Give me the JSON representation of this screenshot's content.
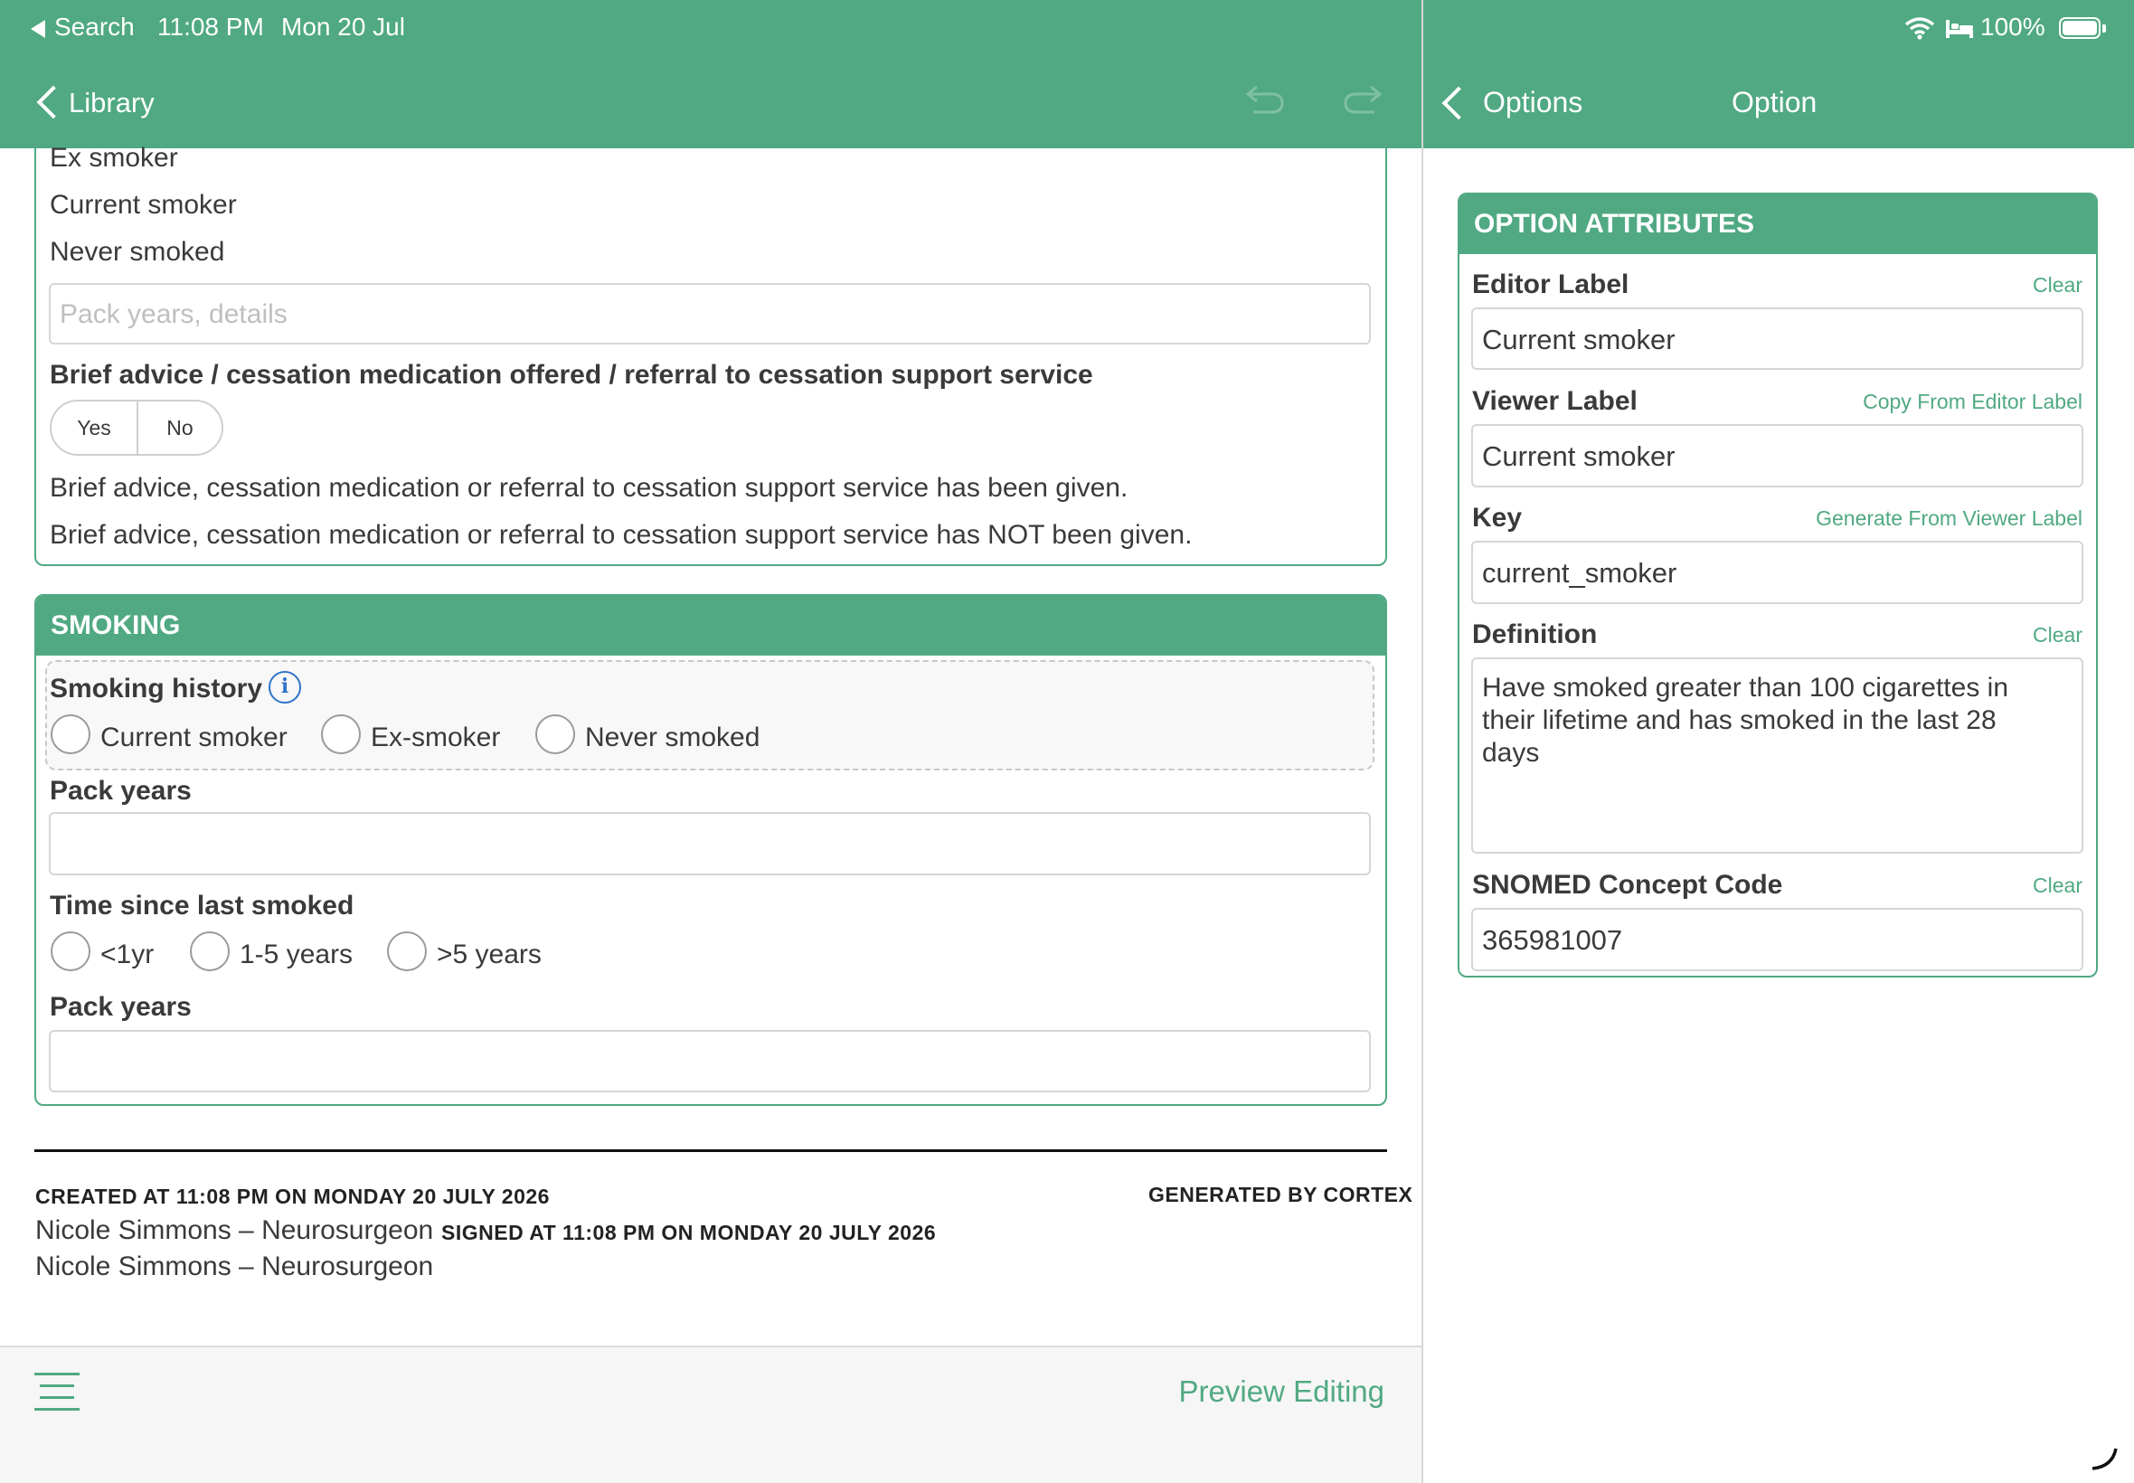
{
  "status_bar": {
    "back_app": "Search",
    "time": "11:08 PM",
    "date": "Mon 20 Jul",
    "battery": "100%"
  },
  "left_nav": {
    "back_label": "Library"
  },
  "right_nav": {
    "back_label": "Options",
    "title": "Option"
  },
  "top_panel": {
    "options": [
      "Ex smoker",
      "Current smoker",
      "Never smoked"
    ],
    "details_placeholder": "Pack years, details",
    "brief_advice_label": "Brief advice / cessation medication offered / referral to cessation support service",
    "yes_label": "Yes",
    "no_label": "No",
    "given_text": "Brief advice, cessation medication or referral to cessation support service has been given.",
    "not_given_text": "Brief advice, cessation medication or referral to cessation support service has NOT been given."
  },
  "smoking": {
    "header": "SMOKING",
    "history_label": "Smoking history",
    "history_options": [
      "Current smoker",
      "Ex-smoker",
      "Never smoked"
    ],
    "pack_years_label": "Pack years",
    "time_since_label": "Time since last smoked",
    "time_options": [
      "<1yr",
      "1-5 years",
      ">5 years"
    ],
    "pack_years_label_2": "Pack years"
  },
  "footer": {
    "created": "CREATED AT 11:08 PM ON MONDAY 20 JULY 2026",
    "generated": "GENERATED BY CORTEX",
    "created_by": "Nicole Simmons – Neurosurgeon",
    "signed": "SIGNED AT 11:08 PM ON MONDAY 20 JULY 2026",
    "signed_by": "Nicole Simmons – Neurosurgeon"
  },
  "bottom_bar": {
    "preview_label": "Preview Editing"
  },
  "option_attributes": {
    "header": "OPTION ATTRIBUTES",
    "editor_label": {
      "label": "Editor Label",
      "action": "Clear",
      "value": "Current smoker"
    },
    "viewer_label": {
      "label": "Viewer Label",
      "action": "Copy From Editor Label",
      "value": "Current smoker"
    },
    "key": {
      "label": "Key",
      "action": "Generate From Viewer Label",
      "value": "current_smoker"
    },
    "definition": {
      "label": "Definition",
      "action": "Clear",
      "value": "Have smoked greater than 100 cigarettes in their lifetime and has smoked in the last 28 days"
    },
    "snomed": {
      "label": "SNOMED Concept Code",
      "action": "Clear",
      "value": "365981007"
    }
  },
  "colors": {
    "accent": "#50a982",
    "info_blue": "#2f73c9"
  }
}
